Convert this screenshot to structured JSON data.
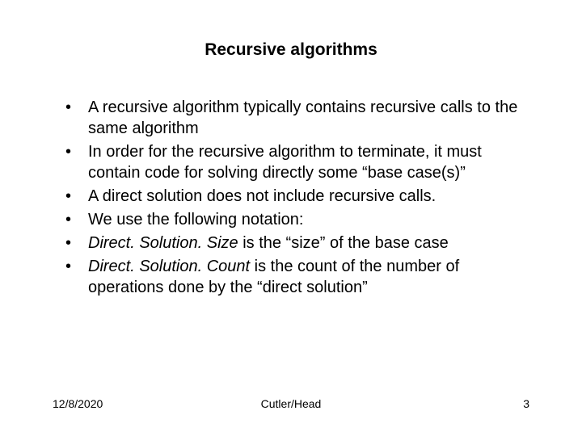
{
  "title": "Recursive algorithms",
  "bullets": [
    {
      "pre": "",
      "em": "",
      "post": "A recursive algorithm typically contains recursive calls to the same algorithm"
    },
    {
      "pre": "",
      "em": "",
      "post": "In order for the recursive algorithm to terminate, it must contain code for solving directly some “base case(s)”"
    },
    {
      "pre": "",
      "em": "",
      "post": "A direct solution does not include recursive calls."
    },
    {
      "pre": "",
      "em": "",
      "post": "We use the following notation:"
    },
    {
      "pre": "",
      "em": "Direct. Solution. Size",
      "post": " is the “size” of the base case"
    },
    {
      "pre": "",
      "em": "Direct. Solution. Count",
      "post": " is the count of the number of operations done by the “direct solution”"
    }
  ],
  "footer": {
    "date": "12/8/2020",
    "author": "Cutler/Head",
    "page": "3"
  }
}
